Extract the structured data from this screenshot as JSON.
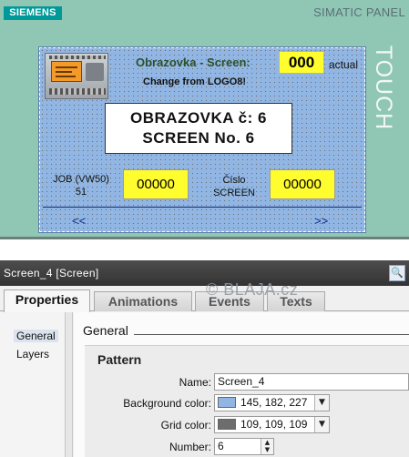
{
  "panel": {
    "brand": "SIEMENS",
    "model": "SIMATIC PANEL",
    "touch_label": "TOUCH",
    "screen": {
      "title": "Obrazovka - Screen:",
      "counter_value": "000",
      "counter_suffix": "actual",
      "subtitle": "Change from LOGO8!",
      "big_line1": "OBRAZOVKA č: 6",
      "big_line2": "SCREEN No. 6",
      "job_label_line1": "JOB (VW50)",
      "job_label_line2": "51",
      "job_value": "00000",
      "cislo_label_line1": "Číslo",
      "cislo_label_line2": "SCREEN",
      "screen_value": "00000",
      "nav_prev": "<<",
      "nav_next": ">>"
    }
  },
  "inspector": {
    "title": "Screen_4 [Screen]",
    "watermark": "© BLAJA.cz",
    "tabs": [
      {
        "label": "Properties",
        "active": true
      },
      {
        "label": "Animations",
        "active": false
      },
      {
        "label": "Events",
        "active": false
      },
      {
        "label": "Texts",
        "active": false
      }
    ],
    "nav_items": [
      "General",
      "Layers"
    ],
    "section_title": "General",
    "group_title": "Pattern",
    "fields": {
      "name_label": "Name:",
      "name_value": "Screen_4",
      "bg_label": "Background color:",
      "bg_value": "145, 182, 227",
      "bg_color": "#91b6e3",
      "grid_label": "Grid color:",
      "grid_value": "109, 109, 109",
      "grid_color": "#6d6d6d",
      "number_label": "Number:",
      "number_value": "6"
    }
  },
  "colors": {
    "panel_bezel": "#8fc7b4",
    "siemens_brand": "#009999",
    "io_field": "#fffd2e"
  }
}
